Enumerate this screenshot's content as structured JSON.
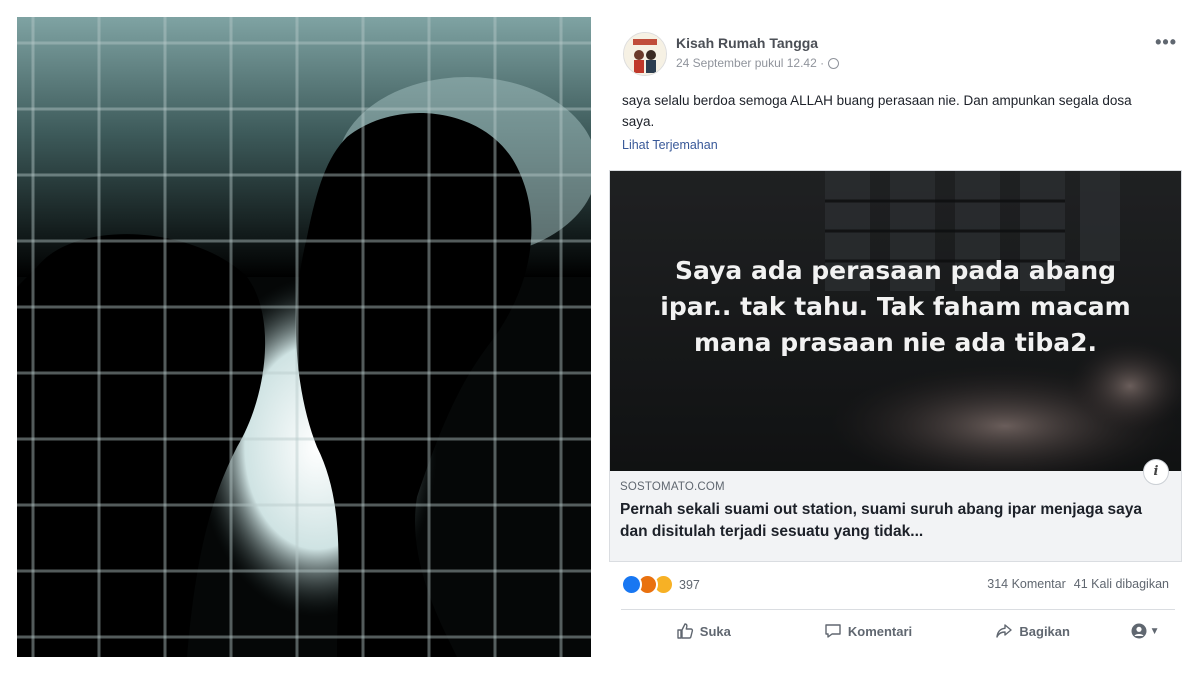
{
  "post": {
    "page_name": "Kisah Rumah Tangga",
    "timestamp": "24 September pukul 12.42 ·",
    "text": "saya selalu berdoa semoga ALLAH buang perasaan nie. Dan ampunkan segala dosa saya.",
    "translate_label": "Lihat Terjemahan",
    "more_label": "•••"
  },
  "link_preview": {
    "overlay_lines": [
      "Saya ada perasaan pada abang",
      "ipar.. tak tahu. Tak faham macam",
      "mana prasaan nie ada tiba2."
    ],
    "info_label": "i",
    "domain": "SOSTOMATO.COM",
    "title": "Pernah sekali suami out station, suami suruh abang ipar menjaga saya dan disitulah terjadi sesuatu yang tidak..."
  },
  "reactions": {
    "icons": [
      "like-icon",
      "angry-icon",
      "sad-icon"
    ],
    "count": "397",
    "comments": "314 Komentar",
    "shares": "41 Kali dibagikan"
  },
  "actions": {
    "like_label": "Suka",
    "comment_label": "Komentari",
    "share_label": "Bagikan"
  },
  "colors": {
    "link": "#385898",
    "secondary_text": "#606770",
    "like_blue": "#1877f2",
    "angry_orange": "#e9710f",
    "sad_yellow": "#f7b125"
  }
}
